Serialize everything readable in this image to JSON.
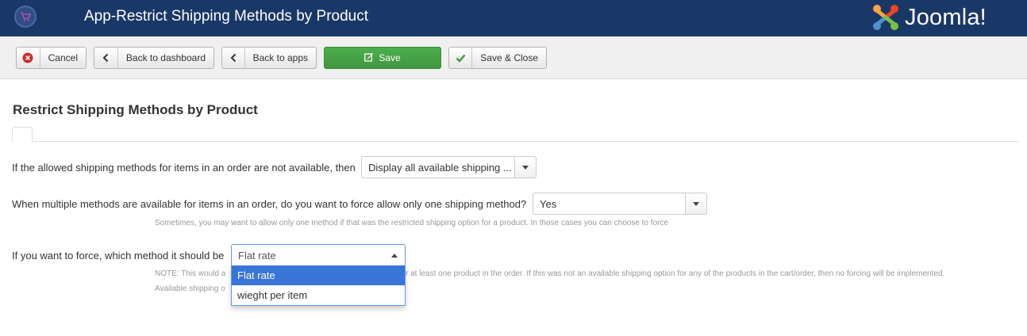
{
  "header": {
    "title": "App-Restrict Shipping Methods by Product",
    "brand": "Joomla!",
    "colors": {
      "bar": "#1a3867"
    }
  },
  "toolbar": {
    "cancel_label": "Cancel",
    "back_dashboard_label": "Back to dashboard",
    "back_apps_label": "Back to apps",
    "save_label": "Save",
    "save_close_label": "Save & Close",
    "icons": [
      "cancel-icon",
      "chevron-left-icon",
      "chevron-left-icon",
      "edit-icon",
      "check-icon"
    ],
    "colors": {
      "save": "#47a447",
      "cancel_icon": "#c9302c",
      "check_icon": "#3c9a3c"
    }
  },
  "main": {
    "title": "Restrict Shipping Methods by Product",
    "fields": [
      {
        "label": "If the allowed shipping methods for items in an order are not available, then",
        "value": "Display all available shipping ..."
      },
      {
        "label": "When multiple methods are available for items in an order, do you want to force allow only one shipping method?",
        "value": "Yes",
        "help": "Sometimes, you may want to allow only one method if that was the restricted shipping option for a product. In those cases you can choose to force"
      },
      {
        "label": "If you want to force, which method it should be",
        "value": "Flat rate",
        "help_line1_a": "NOTE: This would a",
        "help_line1_b": "r at least one product in the order. If this was not an available shipping option for any of the products in the cart/order, then no forcing will be implemented.",
        "help_line2": "Available shipping o",
        "options": [
          "Flat rate",
          "wieght per item"
        ],
        "highlighted_option": "Flat rate"
      }
    ]
  }
}
